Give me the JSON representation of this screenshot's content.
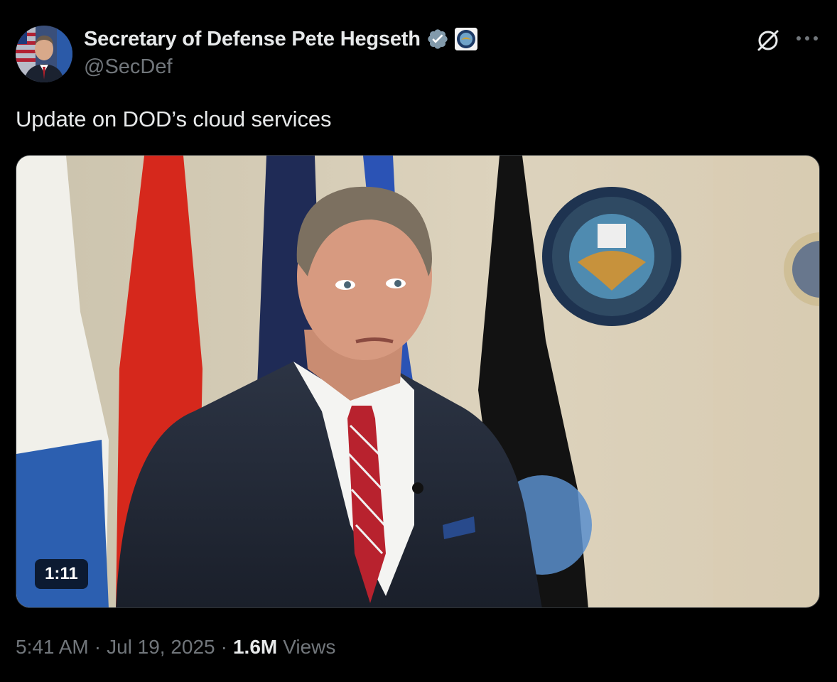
{
  "author": {
    "display_name": "Secretary of Defense Pete Hegseth",
    "handle": "@SecDef",
    "verified_icon": "verified-badge-icon",
    "affiliate_icon": "dod-seal-icon"
  },
  "tweet": {
    "text": "Update on DOD’s cloud services"
  },
  "media": {
    "type": "video",
    "duration": "1:11"
  },
  "meta": {
    "time": "5:41 AM",
    "date": "Jul 19, 2025",
    "separator": "·",
    "views_count": "1.6M",
    "views_label": "Views"
  },
  "actions": {
    "grok_icon": "grok-icon",
    "more_icon": "more-icon"
  },
  "colors": {
    "background": "#000000",
    "primary_text": "#e7e9ea",
    "secondary_text": "#71767b",
    "verified": "#829aab"
  }
}
